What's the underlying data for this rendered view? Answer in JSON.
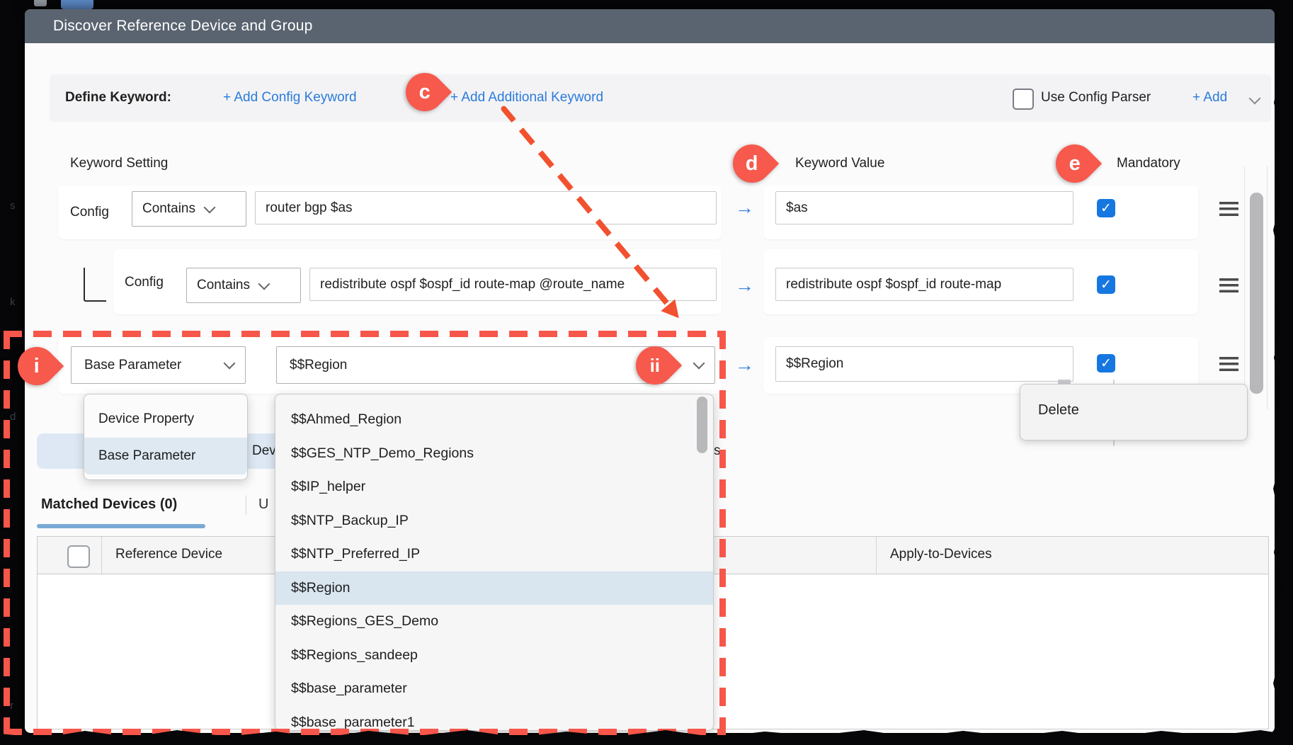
{
  "dialog": {
    "title": "Discover Reference Device and Group"
  },
  "define_keyword": {
    "label": "Define Keyword:",
    "add_config_keyword": "+ Add Config Keyword",
    "add_additional_keyword": "+ Add Additional Keyword",
    "use_config_parser": "Use Config Parser",
    "add_link": "+ Add"
  },
  "columns": {
    "setting": "Keyword Setting",
    "value": "Keyword Value",
    "mandatory": "Mandatory"
  },
  "rows": [
    {
      "type_label": "Config",
      "operator": "Contains",
      "pattern": "router bgp $as",
      "value": "$as",
      "mandatory": true
    },
    {
      "type_label": "Config",
      "operator": "Contains",
      "pattern": "redistribute ospf $ospf_id route-map @route_name",
      "value": "redistribute ospf $ospf_id route-map",
      "mandatory": true
    },
    {
      "operator": "Base Parameter",
      "pattern": "$$Region",
      "value": "$$Region",
      "mandatory": true
    }
  ],
  "type_menu": {
    "items": [
      "Device Property",
      "Base Parameter"
    ],
    "selected": "Base Parameter"
  },
  "param_dropdown": {
    "selected": "$$Region",
    "options": [
      "$$Ahmed_Region",
      "$$GES_NTP_Demo_Regions",
      "$$IP_helper",
      "$$NTP_Backup_IP",
      "$$NTP_Preferred_IP",
      "$$Region",
      "$$Regions_GES_Demo",
      "$$Regions_sandeep",
      "$$base_parameter",
      "$$base_parameter1"
    ]
  },
  "context_menu": {
    "delete": "Delete"
  },
  "tabs": {
    "matched": "Matched Devices (0)",
    "unmatched_fragment": "U"
  },
  "hidden_bar": {
    "fragment_left": "Dev",
    "fragment_right": "s"
  },
  "table": {
    "headers": {
      "reference_device": "Reference Device",
      "apply_to_devices": "Apply-to-Devices"
    }
  },
  "annotations": {
    "c": "c",
    "d": "d",
    "e": "e",
    "i": "i",
    "ii": "ii"
  },
  "background_fragments": {
    "f1": "s",
    "f2": "k",
    "f3": "d",
    "f4": "r"
  },
  "colors": {
    "annotation_red": "#f7594c",
    "link_blue": "#2a7bdc",
    "checkbox_blue": "#1677e0",
    "titlebar_slate": "#5a6470",
    "tab_underline_blue": "#79aad5",
    "dropdown_highlight": "#d9e5ef",
    "hidden_bar_blue": "#dde8f4"
  }
}
